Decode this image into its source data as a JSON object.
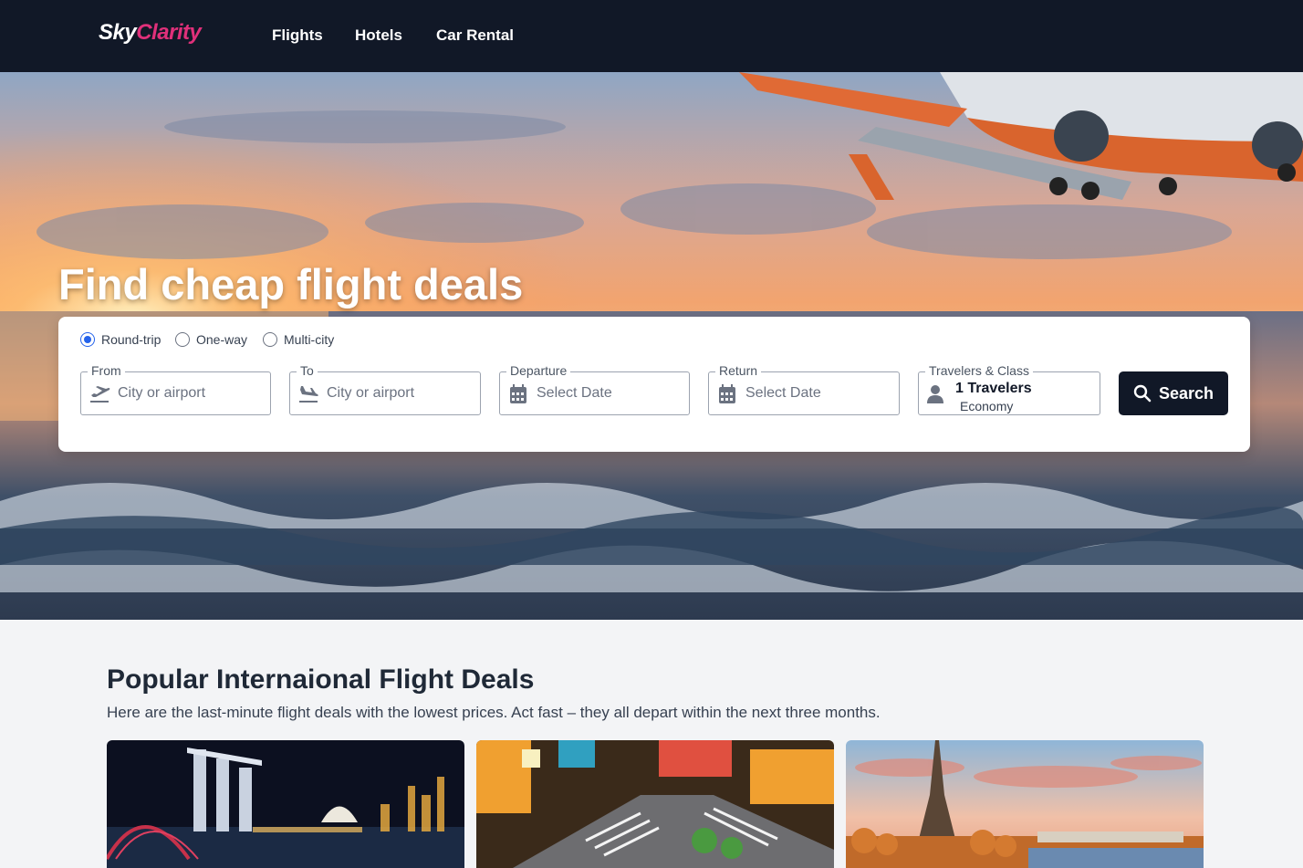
{
  "brand": {
    "part1": "Sky",
    "part2": "Clarity"
  },
  "nav": {
    "links": [
      "Flights",
      "Hotels",
      "Car Rental"
    ]
  },
  "hero": {
    "title": "Find cheap flight deals"
  },
  "search": {
    "trip_types": [
      {
        "label": "Round-trip",
        "selected": true
      },
      {
        "label": "One-way",
        "selected": false
      },
      {
        "label": "Multi-city",
        "selected": false
      }
    ],
    "from": {
      "label": "From",
      "placeholder": "City or airport",
      "icon": "plane-departure-icon"
    },
    "to": {
      "label": "To",
      "placeholder": "City or airport",
      "icon": "plane-arrival-icon"
    },
    "departure": {
      "label": "Departure",
      "placeholder": "Select Date",
      "icon": "calendar-icon"
    },
    "return": {
      "label": "Return",
      "placeholder": "Select Date",
      "icon": "calendar-icon"
    },
    "travelers": {
      "label": "Travelers & Class",
      "count_text": "1 Travelers",
      "class": "Economy",
      "icon": "user-icon"
    },
    "button_label": "Search",
    "button_icon": "search-icon"
  },
  "deals": {
    "title": "Popular Internaional Flight Deals",
    "subtitle": "Here are the last-minute flight deals with the lowest prices. Act fast – they all depart within the next three months.",
    "cards": [
      {
        "image": "singapore-skyline-night-photo"
      },
      {
        "image": "tokyo-shibuya-crossing-photo"
      },
      {
        "image": "paris-eiffel-tower-photo"
      }
    ]
  },
  "colors": {
    "nav_bg": "#111827",
    "brand_accent": "#e0307a",
    "radio_accent": "#2563eb",
    "button_bg": "#111827"
  }
}
